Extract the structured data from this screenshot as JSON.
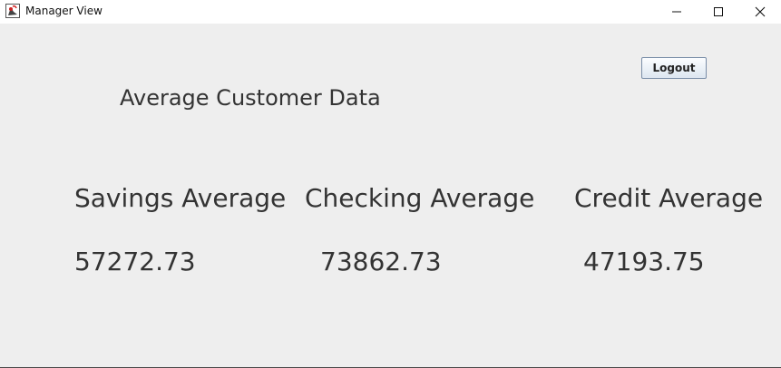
{
  "window": {
    "title": "Manager View",
    "app_icon": "java-duke-icon",
    "controls": {
      "minimize_icon": "minimize-icon",
      "maximize_icon": "maximize-icon",
      "close_icon": "close-icon"
    }
  },
  "main": {
    "heading": "Average Customer Data",
    "logout_label": "Logout",
    "averages": [
      {
        "label": "Savings Average",
        "value": "57272.73"
      },
      {
        "label": "Checking Average",
        "value": "73862.73"
      },
      {
        "label": "Credit Average",
        "value": "47193.75"
      }
    ]
  },
  "colors": {
    "background": "#eeeeee",
    "titlebar": "#ffffff",
    "text": "#333333",
    "button_border": "#7a8ea8"
  }
}
